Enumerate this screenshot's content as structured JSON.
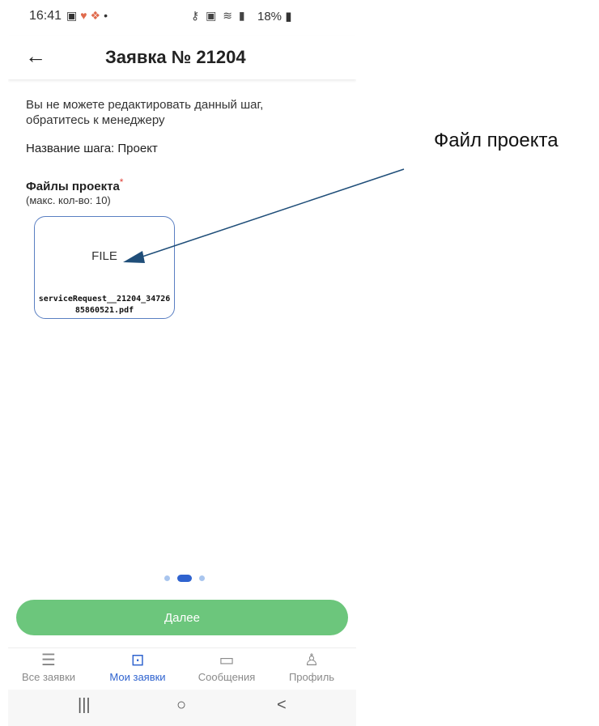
{
  "status_bar": {
    "time": "16:41",
    "battery": "18%",
    "left_icons": [
      "gallery-icon",
      "heart-icon",
      "dropbox-icon",
      "dot-icon"
    ],
    "right_icons": [
      "key-icon",
      "lock-icon",
      "wifi-icon",
      "signal-icon"
    ]
  },
  "header": {
    "title": "Заявка № 21204",
    "back_icon": "arrow-left-icon"
  },
  "content": {
    "warning": "Вы не можете редактировать данный шаг, обратитесь к менеджеру",
    "step_line": "Название шага: Проект",
    "files_label": "Файлы проекта",
    "required_mark": "*",
    "files_limit": "(макс. кол-во: 10)",
    "file": {
      "type": "FILE",
      "name": "serviceRequest__21204_3472685860521.pdf"
    }
  },
  "pager": {
    "count": 3,
    "active": 2
  },
  "next_button": "Далее",
  "tabs": [
    {
      "label": "Все заявки",
      "icon": "list-icon",
      "active": false
    },
    {
      "label": "Мои заявки",
      "icon": "bag-icon",
      "active": true
    },
    {
      "label": "Сообщения",
      "icon": "chat-icon",
      "active": false
    },
    {
      "label": "Профиль",
      "icon": "person-icon",
      "active": false
    }
  ],
  "nav": {
    "recent": "|||",
    "home": "○",
    "back": "<"
  },
  "annotation": {
    "text": "Файл проекта"
  },
  "colors": {
    "primary": "#2f63cf",
    "button": "#6cc67c",
    "arrow": "#1f4e79"
  }
}
